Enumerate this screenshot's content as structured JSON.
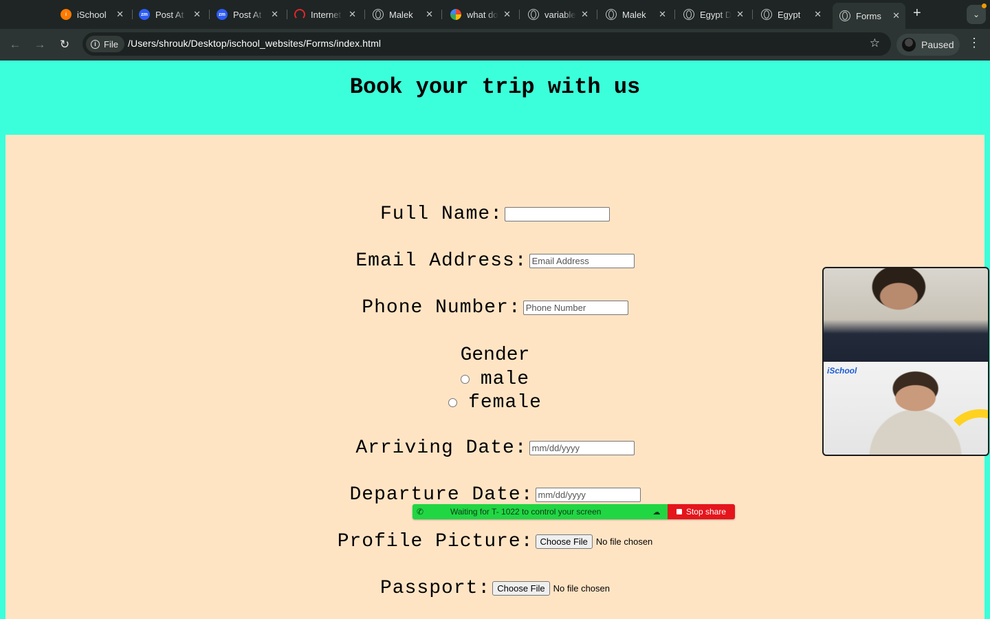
{
  "browser": {
    "tabs": [
      {
        "title": "iSchool",
        "icon": "ischool-favicon"
      },
      {
        "title": "Post At",
        "icon": "zoom-favicon"
      },
      {
        "title": "Post At",
        "icon": "zoom-favicon"
      },
      {
        "title": "Internet",
        "icon": "speedtest-favicon"
      },
      {
        "title": "Malek",
        "icon": "globe-icon"
      },
      {
        "title": "what do",
        "icon": "google-favicon"
      },
      {
        "title": "variable",
        "icon": "globe-icon"
      },
      {
        "title": "Malek",
        "icon": "globe-icon"
      },
      {
        "title": "Egypt D",
        "icon": "globe-icon"
      },
      {
        "title": "Egypt",
        "icon": "globe-icon"
      },
      {
        "title": "Forms",
        "icon": "globe-icon",
        "active": true
      }
    ],
    "address": {
      "chip_label": "File",
      "url": "/Users/shrouk/Desktop/ischool_websites/Forms/index.html"
    },
    "profile_label": "Paused"
  },
  "page": {
    "heading": "Book your trip with us",
    "form": {
      "full_name_label": "Full Name:",
      "full_name_value": "",
      "email_label": "Email Address:",
      "email_placeholder": "Email Address",
      "phone_label": "Phone Number:",
      "phone_placeholder": "Phone Number",
      "gender_label": "Gender",
      "gender_options": [
        "male",
        "female"
      ],
      "arriving_label": "Arriving Date:",
      "arriving_placeholder": "mm/dd/yyyy",
      "departure_label": "Departure Date:",
      "departure_placeholder": "mm/dd/yyyy",
      "profile_label": "Profile Picture:",
      "passport_label": "Passport:",
      "choose_file_label": "Choose File",
      "no_file_text": "No file chosen"
    }
  },
  "screen_share": {
    "message": "Waiting for T- 1022 to control your screen",
    "stop_label": "Stop share"
  },
  "video_panel": {
    "logo_text": "iSchool"
  },
  "colors": {
    "page_bg": "#3bffda",
    "form_bg": "#ffe4c4",
    "share_green": "#21d643",
    "stop_red": "#e5151c"
  }
}
